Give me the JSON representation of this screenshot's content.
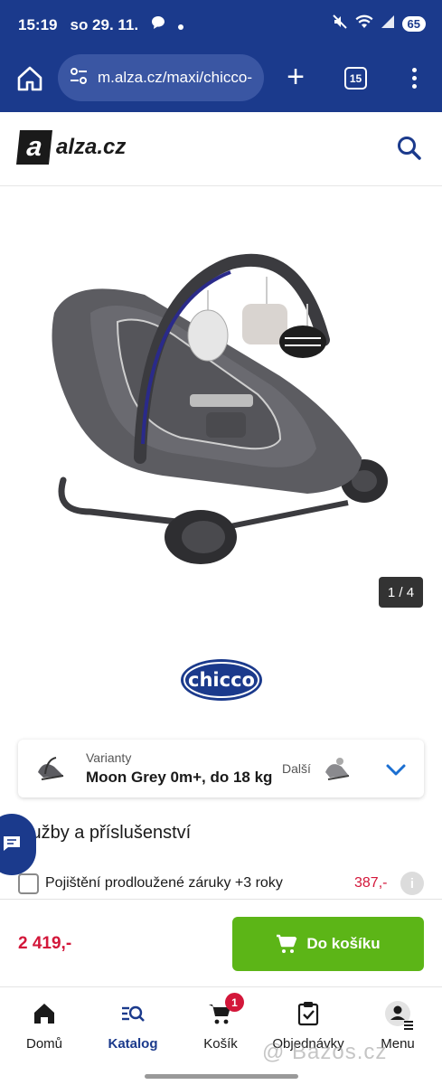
{
  "status_bar": {
    "time": "15:19",
    "date": "so 29. 11.",
    "battery": "65",
    "icons": [
      "chat-bubble-icon",
      "dot-icon",
      "mute-icon",
      "wifi-icon",
      "signal-icon",
      "battery-icon"
    ]
  },
  "browser": {
    "url": "m.alza.cz/maxi/chicco-",
    "tabs_count": "15",
    "icons": [
      "home-icon",
      "site-settings-icon",
      "new-tab-icon",
      "tabs-icon",
      "more-icon"
    ]
  },
  "site": {
    "logo_mark": "a",
    "logo_text": "alza",
    "logo_tld": ".cz"
  },
  "gallery": {
    "counter": "1 / 4"
  },
  "brand": {
    "name": "chicco"
  },
  "variant": {
    "label": "Varianty",
    "value": "Moon Grey 0m+, do 18 kg",
    "next_label": "Další"
  },
  "services": {
    "title": "lužby a příslušenství",
    "items": [
      {
        "label": "Pojištění prodloužené záruky +3 roky",
        "price": "387,-",
        "info": "i"
      }
    ]
  },
  "buy": {
    "price": "2 419,-",
    "button_label": "Do košíku"
  },
  "nav": {
    "items": [
      {
        "label": "Domů",
        "icon": "home-icon"
      },
      {
        "label": "Katalog",
        "icon": "catalog-search-icon"
      },
      {
        "label": "Košík",
        "icon": "cart-icon",
        "badge": "1"
      },
      {
        "label": "Objednávky",
        "icon": "orders-clipboard-icon"
      },
      {
        "label": "Menu",
        "icon": "user-menu-icon"
      }
    ],
    "active": "Katalog"
  },
  "watermark": "@ Bazos.cz",
  "colors": {
    "primary_blue": "#1b3a8c",
    "buy_green": "#5cb517",
    "price_red": "#d3173a"
  }
}
